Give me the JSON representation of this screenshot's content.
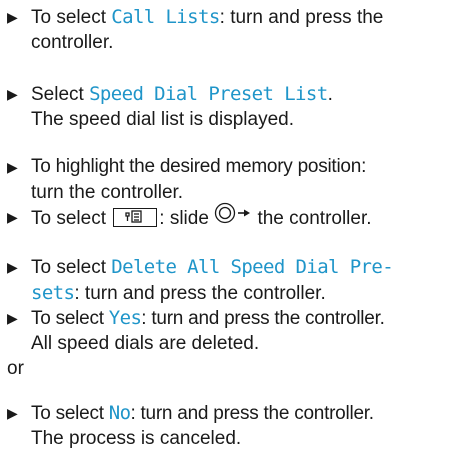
{
  "steps": [
    {
      "lines": [
        {
          "pre": "To select ",
          "display": "Call Lists",
          "post": ": turn and press the"
        },
        {
          "text": "controller."
        }
      ]
    },
    {
      "lines": [
        {
          "pre": "Select ",
          "display": "Speed Dial Preset List",
          "post": "."
        },
        {
          "text": "The speed dial list is displayed."
        }
      ]
    },
    {
      "lines": [
        {
          "text": "To highlight the desired memory position:"
        },
        {
          "text": "turn the controller."
        }
      ]
    },
    {
      "lines": [
        {
          "pre": "To select ",
          "post": ": slide ",
          "post2": " the controller."
        }
      ]
    },
    {
      "lines": [
        {
          "pre": "To select ",
          "display": "Delete All Speed Dial Pre-"
        },
        {
          "display": "sets",
          "post": ": turn and press the controller."
        }
      ]
    },
    {
      "lines": [
        {
          "pre": "To select ",
          "display": "Yes",
          "post": ": turn and press the controller."
        },
        {
          "text": "All speed dials are deleted."
        }
      ]
    },
    {
      "lines": [
        {
          "pre": "To select ",
          "display": "No",
          "post": ": turn and press the controller."
        },
        {
          "text": "The process is canceled."
        }
      ]
    }
  ],
  "or_text": "or",
  "icons": {
    "bullet": "triangle-right-icon",
    "softkey": "phonebook-softkey-icon",
    "controller": "controller-slide-right-icon"
  },
  "colors": {
    "text": "#1a1a1a",
    "display_text": "#1f95c9"
  }
}
